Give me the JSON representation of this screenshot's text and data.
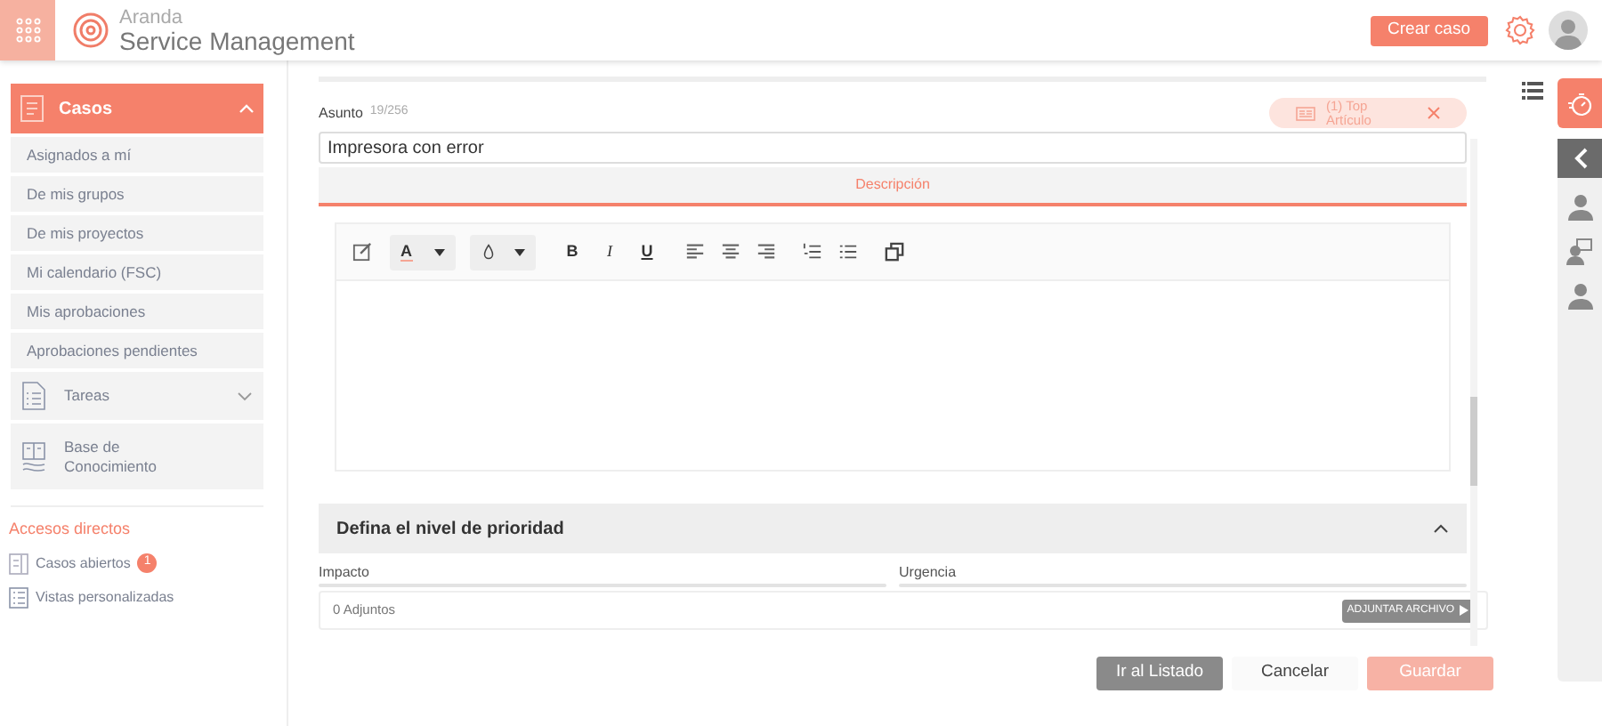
{
  "header": {
    "brand_top": "Aranda",
    "brand_bottom": "Service Management",
    "create_button": "Crear caso"
  },
  "sidebar": {
    "section": {
      "label": "Casos",
      "expanded": true
    },
    "items": [
      {
        "label": "Asignados a mí"
      },
      {
        "label": "De mis grupos"
      },
      {
        "label": "De mis proyectos"
      },
      {
        "label": "Mi calendario (FSC)"
      },
      {
        "label": "Mis aprobaciones"
      },
      {
        "label": "Aprobaciones pendientes"
      }
    ],
    "groups": [
      {
        "kind": "tasks",
        "label": "Tareas",
        "expanded": false
      },
      {
        "kind": "knowledge",
        "label": "Base de Conocimiento"
      }
    ],
    "shortcuts_title": "Accesos directos",
    "shortcuts": [
      {
        "kind": "cases",
        "label": "Casos abiertos",
        "badge": "1"
      },
      {
        "kind": "views",
        "label": "Vistas personalizadas"
      }
    ]
  },
  "form": {
    "subject_label": "Asunto",
    "subject_counter": "19/256",
    "subject_value": "Impresora con error",
    "article_chip": "(1) Top Artículo",
    "tabs": [
      {
        "label": "Descripción",
        "selected": true
      }
    ],
    "toolbar": [
      {
        "kind": "edit"
      },
      {
        "kind": "color",
        "label": "A"
      },
      {
        "kind": "fill"
      },
      {
        "kind": "bold",
        "label": "B"
      },
      {
        "kind": "italic",
        "label": "I"
      },
      {
        "kind": "underline",
        "label": "U"
      },
      {
        "kind": "align-left"
      },
      {
        "kind": "align-center"
      },
      {
        "kind": "align-right"
      },
      {
        "kind": "ordered-list"
      },
      {
        "kind": "bullet-list"
      },
      {
        "kind": "window"
      }
    ],
    "priority": {
      "title": "Defina el nivel de prioridad",
      "expanded": true,
      "fields": [
        {
          "label": "Impacto"
        },
        {
          "label": "Urgencia"
        }
      ]
    },
    "attachments": "0 Adjuntos",
    "attach_button": "ADJUNTAR ARCHIVO"
  },
  "footer": {
    "buttons": [
      {
        "kind": "secondary",
        "label": "Ir al Listado"
      },
      {
        "kind": "plain",
        "label": "Cancelar"
      },
      {
        "kind": "primary",
        "label": "Guardar"
      }
    ]
  }
}
